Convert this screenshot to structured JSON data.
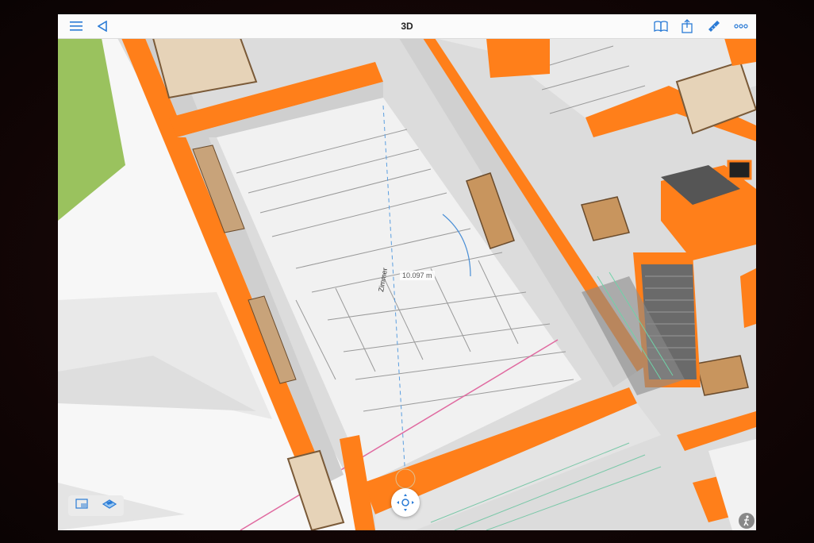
{
  "toolbar": {
    "title": "3D",
    "left_icons": [
      "hamburger-menu-icon",
      "back-triangle-icon"
    ],
    "right_icons": [
      "book-icon",
      "share-icon",
      "ruler-icon",
      "more-dots-icon"
    ]
  },
  "viewport": {
    "measurement_label": "10.097 m",
    "floor_label": "Zimmer"
  },
  "bottom_tools": {
    "icons": [
      "view-mode-2d-icon",
      "view-mode-3d-icon"
    ]
  },
  "navigation": {
    "icon": "navigation-pad-icon"
  },
  "walk": {
    "icon": "walk-person-icon"
  },
  "colors": {
    "wall_top": "#ff7f1a",
    "accent": "#1e7cd6",
    "floor": "#f2f2f2",
    "wall_side": "#cfcfcf",
    "grass": "#9ac25e"
  }
}
